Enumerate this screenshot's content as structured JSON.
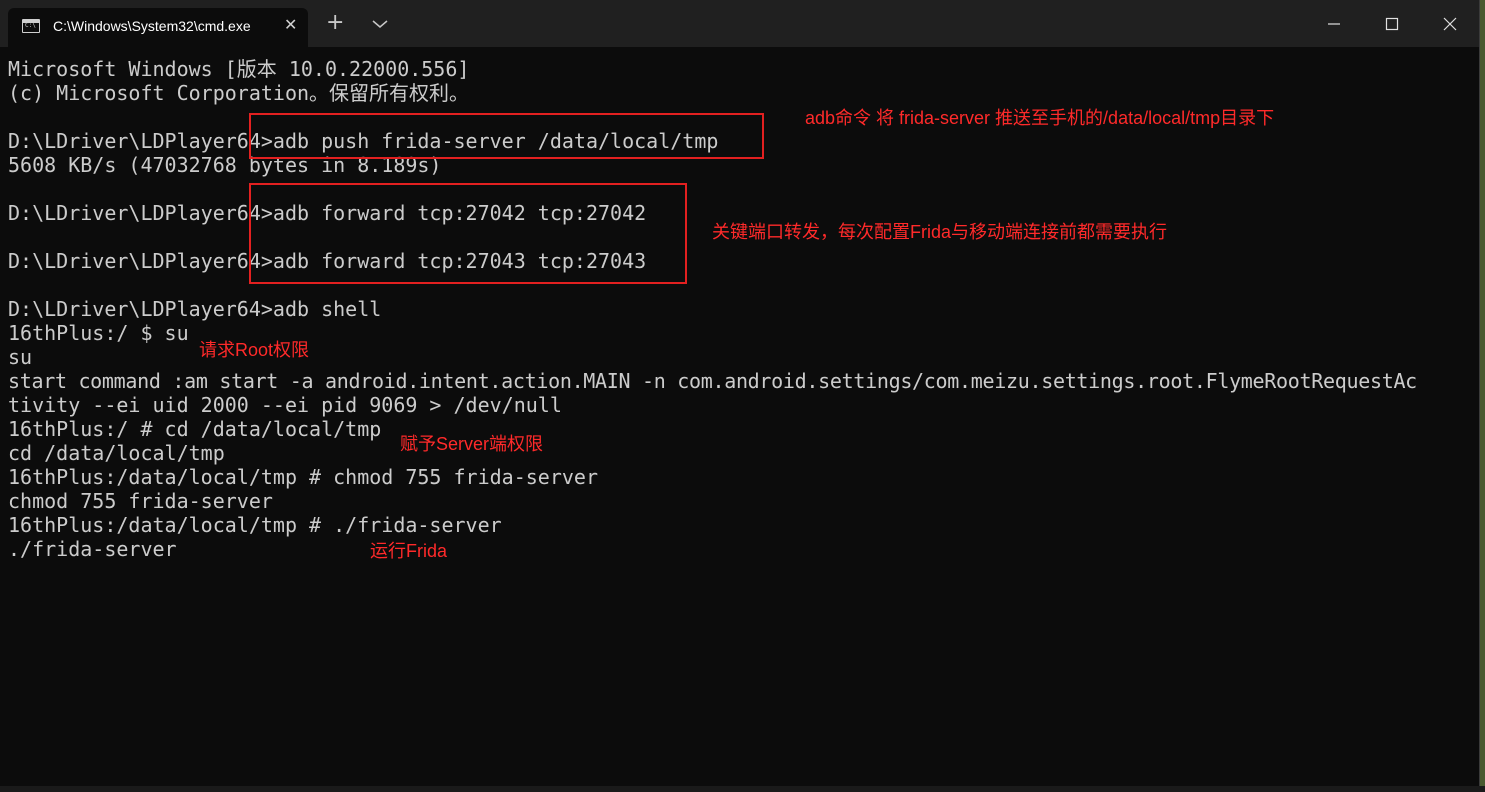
{
  "window": {
    "tab_title": "C:\\Windows\\System32\\cmd.exe",
    "tab_close": "✕",
    "new_tab": "+",
    "minimize": "—",
    "maximize": "☐",
    "close": "✕"
  },
  "terminal": {
    "lines": [
      "Microsoft Windows [版本 10.0.22000.556]",
      "(c) Microsoft Corporation。保留所有权利。",
      "",
      "D:\\LDriver\\LDPlayer64>adb push frida-server /data/local/tmp",
      "5608 KB/s (47032768 bytes in 8.189s)",
      "",
      "D:\\LDriver\\LDPlayer64>adb forward tcp:27042 tcp:27042",
      "",
      "D:\\LDriver\\LDPlayer64>adb forward tcp:27043 tcp:27043",
      "",
      "D:\\LDriver\\LDPlayer64>adb shell",
      "16thPlus:/ $ su",
      "su",
      "start command :am start -a android.intent.action.MAIN -n com.android.settings/com.meizu.settings.root.FlymeRootRequestAc",
      "tivity --ei uid 2000 --ei pid 9069 > /dev/null",
      "16thPlus:/ # cd /data/local/tmp",
      "cd /data/local/tmp",
      "16thPlus:/data/local/tmp # chmod 755 frida-server",
      "chmod 755 frida-server",
      "16thPlus:/data/local/tmp # ./frida-server",
      "./frida-server"
    ]
  },
  "annotations": {
    "push_note": "adb命令 将 frida-server 推送至手机的/data/local/tmp目录下",
    "forward_note": "关键端口转发，每次配置Frida与移动端连接前都需要执行",
    "root_note": "请求Root权限",
    "chmod_note": "赋予Server端权限",
    "run_note": "运行Frida"
  },
  "colors": {
    "terminal_bg": "#0c0c0c",
    "terminal_text": "#cccccc",
    "annotation_red": "#ff2a2a",
    "titlebar_bg": "#202020"
  }
}
